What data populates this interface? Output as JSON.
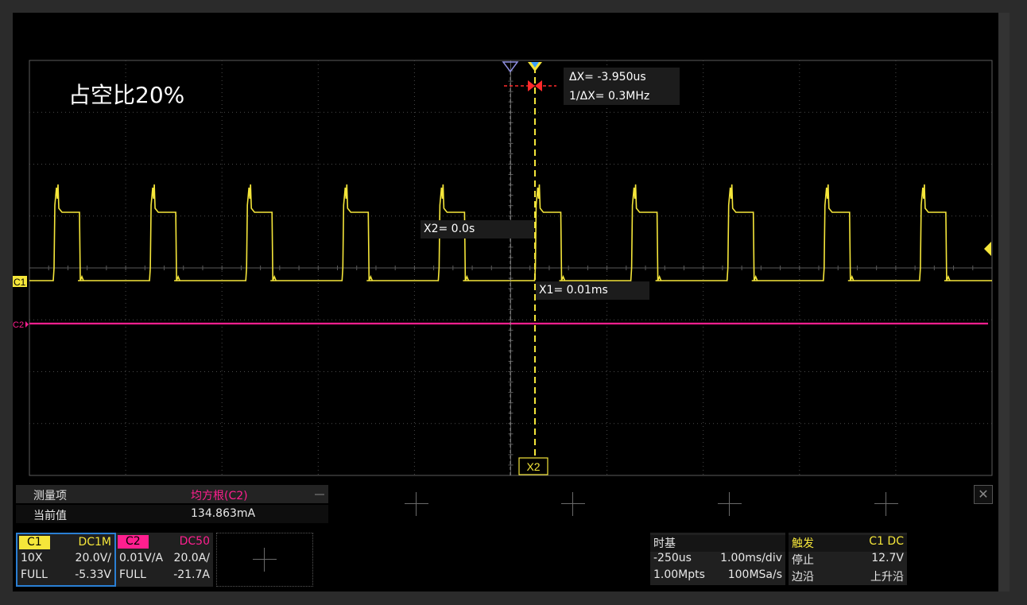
{
  "annotation_title": "占空比20%",
  "cursors": {
    "delta_x": "ΔX= -3.950us",
    "inv_delta_x": "1/ΔX= 0.3MHz",
    "x2_readout": "X2= 0.0s",
    "x1_readout": "X1= 0.01ms",
    "x2_tag": "X2"
  },
  "channel_markers": {
    "c1": "C1",
    "c2": "C2"
  },
  "measurements": {
    "header_label": "测量项",
    "header_value": "均方根(C2)",
    "current_label": "当前值",
    "current_value": "134.863mA"
  },
  "channel1": {
    "name": "C1",
    "coupling": "DC1M",
    "probe": "10X",
    "scale": "20.0V/",
    "bandwidth": "FULL",
    "offset": "-5.33V"
  },
  "channel2": {
    "name": "C2",
    "coupling": "DC50",
    "probe": "0.01V/A",
    "scale": "20.0A/",
    "bandwidth": "FULL",
    "offset": "-21.7A"
  },
  "timebase": {
    "title": "时基",
    "delay": "-250us",
    "scale": "1.00ms/div",
    "memory": "1.00Mpts",
    "sample_rate": "100MSa/s"
  },
  "trigger": {
    "title": "触发",
    "source": "C1 DC",
    "state": "停止",
    "level": "12.7V",
    "type": "边沿",
    "slope": "上升沿"
  },
  "colors": {
    "ch1": "#f5e63a",
    "ch2": "#ff1f8f",
    "cursor_red": "#ff2a2a",
    "cursor_blue": "#3da0ff"
  }
}
